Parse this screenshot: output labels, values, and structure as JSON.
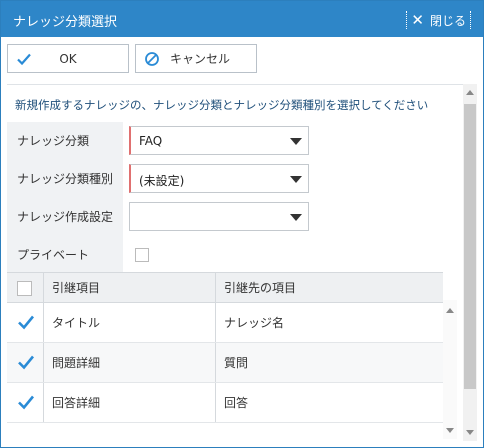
{
  "dialog": {
    "title": "ナレッジ分類選択",
    "close_label": "閉じる"
  },
  "toolbar": {
    "ok_label": "OK",
    "cancel_label": "キャンセル"
  },
  "instruction": "新規作成するナレッジの、ナレッジ分類とナレッジ分類種別を選択してください",
  "form": {
    "category": {
      "label": "ナレッジ分類",
      "value": "FAQ"
    },
    "category_type": {
      "label": "ナレッジ分類種別",
      "value": "(未設定)"
    },
    "creation_setting": {
      "label": "ナレッジ作成設定",
      "value": ""
    },
    "private": {
      "label": "プライベート",
      "checked": false
    }
  },
  "grid": {
    "headers": [
      "引継項目",
      "引継先の項目"
    ],
    "rows": [
      {
        "checked": true,
        "item": "タイトル",
        "target": "ナレッジ名"
      },
      {
        "checked": true,
        "item": "問題詳細",
        "target": "質問"
      },
      {
        "checked": true,
        "item": "回答詳細",
        "target": "回答"
      }
    ]
  },
  "colors": {
    "titlebar": "#2e86c8",
    "accent": "#2a8bd6",
    "required_marker": "#e07070"
  }
}
